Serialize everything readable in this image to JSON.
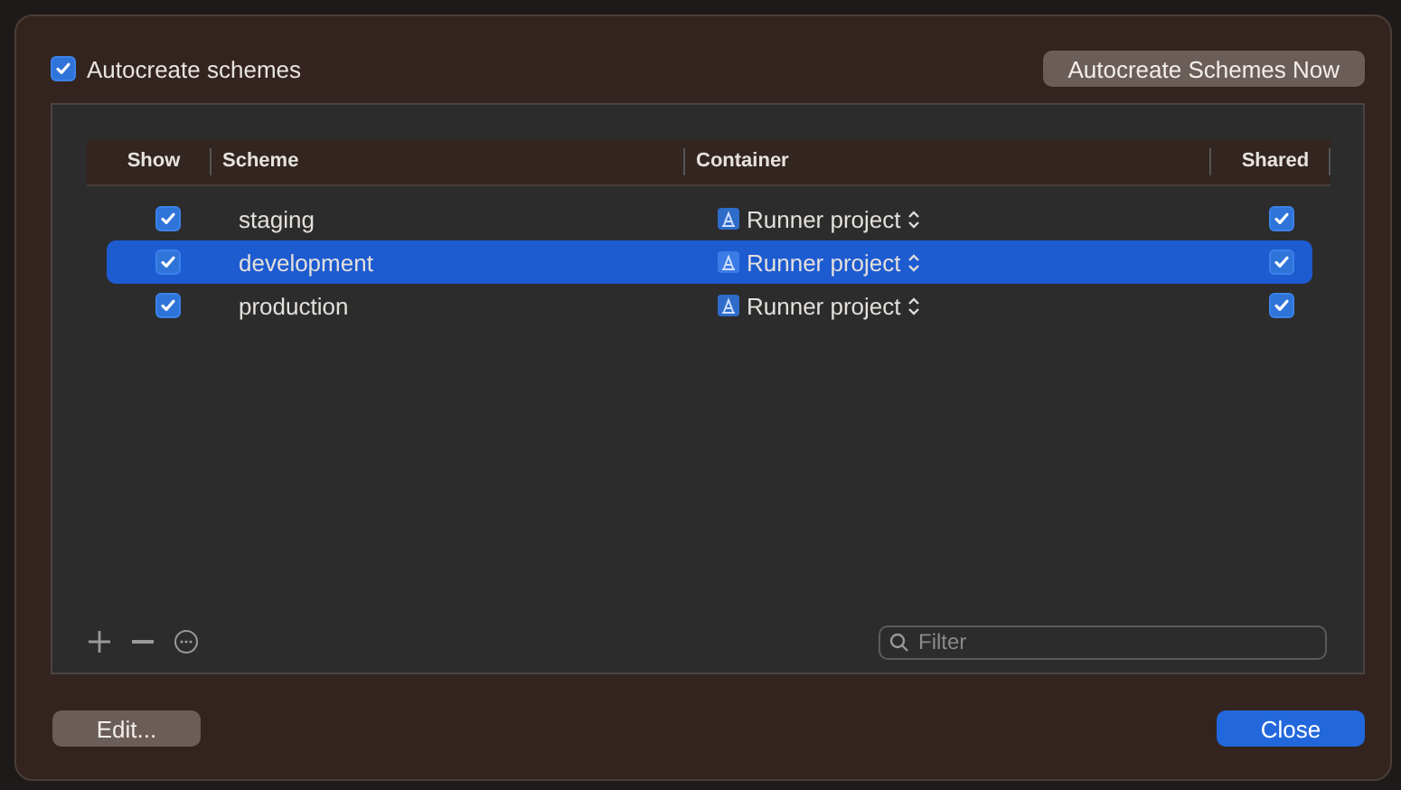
{
  "autocreate": {
    "label": "Autocreate schemes",
    "checked": true
  },
  "autocreate_now_button": "Autocreate Schemes Now",
  "table": {
    "columns": [
      "Show",
      "Scheme",
      "Container",
      "Shared"
    ],
    "rows": [
      {
        "show": true,
        "scheme": "staging",
        "container": "Runner project",
        "shared": true,
        "selected": false
      },
      {
        "show": true,
        "scheme": "development",
        "container": "Runner project",
        "shared": true,
        "selected": true
      },
      {
        "show": true,
        "scheme": "production",
        "container": "Runner project",
        "shared": true,
        "selected": false
      }
    ]
  },
  "filter": {
    "placeholder": "Filter"
  },
  "buttons": {
    "edit": "Edit...",
    "close": "Close"
  }
}
